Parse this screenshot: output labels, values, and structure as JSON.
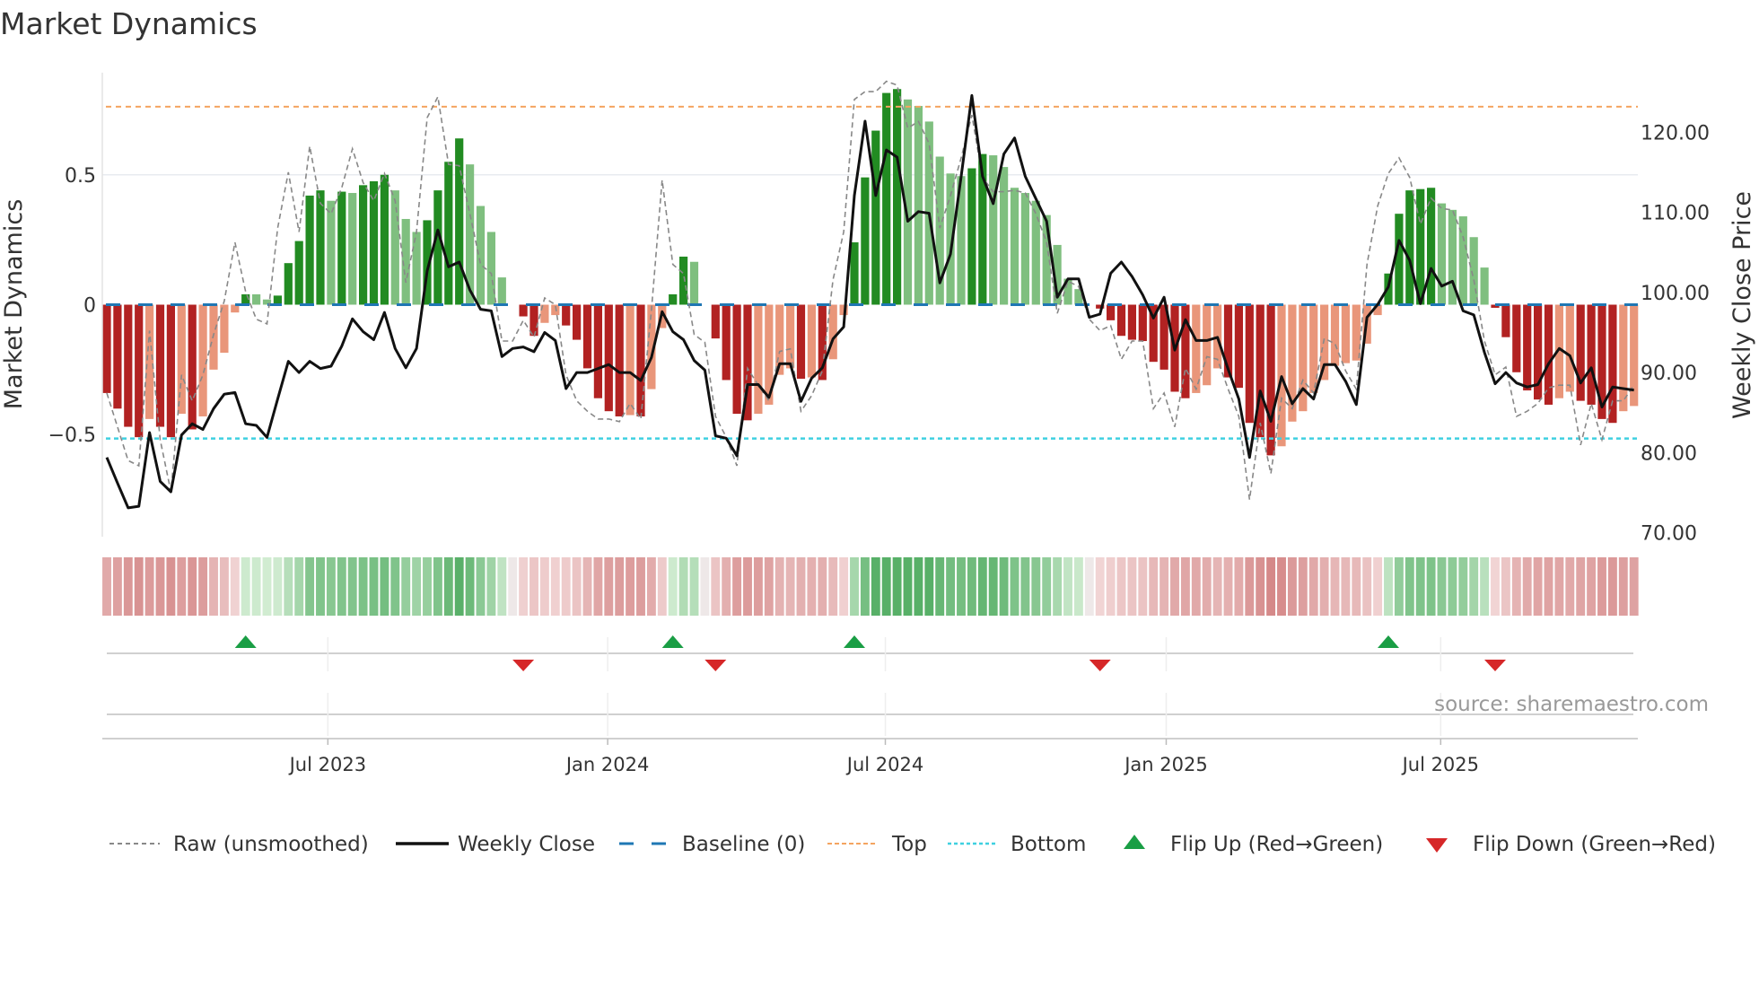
{
  "chart_data": {
    "type": "bar",
    "title": "Market Dynamics",
    "ylabel_left": "Market Dynamics",
    "ylabel_right": "Weekly Close Price",
    "ylim_left": [
      -0.893,
      0.893
    ],
    "ylim_right": [
      69.5,
      127.45
    ],
    "left_ticks": [
      {
        "v": 0.5,
        "label": "0.5"
      },
      {
        "v": 0,
        "label": "0"
      },
      {
        "v": -0.5,
        "label": "−0.5"
      }
    ],
    "right_ticks": [
      {
        "v": 120,
        "label": "120.00"
      },
      {
        "v": 110,
        "label": "110.00"
      },
      {
        "v": 100,
        "label": "100.00"
      },
      {
        "v": 90,
        "label": "90.00"
      },
      {
        "v": 80,
        "label": "80.00"
      },
      {
        "v": 70,
        "label": "70.00"
      }
    ],
    "x_unit": "week index",
    "x_ticks": [
      {
        "week": 20.7,
        "label": "Jul 2023"
      },
      {
        "week": 46.9,
        "label": "Jan 2024"
      },
      {
        "week": 72.9,
        "label": "Jul 2024"
      },
      {
        "week": 99.2,
        "label": "Jan 2025"
      },
      {
        "week": 124.9,
        "label": "Jul 2025"
      }
    ],
    "top_level": 0.762,
    "bottom_level": -0.515,
    "baseline": 0,
    "momentum": [
      -0.34,
      -0.4,
      -0.47,
      -0.51,
      -0.44,
      -0.47,
      -0.51,
      -0.42,
      -0.48,
      -0.43,
      -0.25,
      -0.185,
      -0.03,
      0.04,
      0.04,
      0.02,
      0.035,
      0.16,
      0.245,
      0.42,
      0.44,
      0.4,
      0.435,
      0.43,
      0.46,
      0.475,
      0.5,
      0.44,
      0.33,
      0.28,
      0.325,
      0.44,
      0.55,
      0.64,
      0.54,
      0.38,
      0.28,
      0.105,
      0,
      -0.045,
      -0.12,
      -0.07,
      -0.04,
      -0.08,
      -0.135,
      -0.245,
      -0.36,
      -0.41,
      -0.43,
      -0.425,
      -0.43,
      -0.325,
      -0.09,
      0.04,
      0.185,
      0.165,
      0,
      -0.13,
      -0.29,
      -0.42,
      -0.445,
      -0.42,
      -0.385,
      -0.27,
      -0.245,
      -0.285,
      -0.28,
      -0.29,
      -0.21,
      -0.04,
      0.24,
      0.49,
      0.67,
      0.815,
      0.83,
      0.79,
      0.765,
      0.705,
      0.57,
      0.505,
      0.495,
      0.525,
      0.58,
      0.575,
      0.53,
      0.45,
      0.43,
      0.4,
      0.345,
      0.23,
      0.1,
      0.06,
      0,
      -0.015,
      -0.06,
      -0.12,
      -0.135,
      -0.14,
      -0.22,
      -0.25,
      -0.335,
      -0.36,
      -0.34,
      -0.31,
      -0.245,
      -0.28,
      -0.32,
      -0.455,
      -0.51,
      -0.58,
      -0.545,
      -0.45,
      -0.41,
      -0.34,
      -0.29,
      -0.235,
      -0.225,
      -0.215,
      -0.15,
      -0.04,
      0.12,
      0.35,
      0.44,
      0.445,
      0.45,
      0.39,
      0.365,
      0.34,
      0.26,
      0.143,
      -0.012,
      -0.125,
      -0.26,
      -0.33,
      -0.365,
      -0.385,
      -0.36,
      -0.335,
      -0.37,
      -0.385,
      -0.44,
      -0.455,
      -0.41,
      -0.39
    ],
    "raw": [
      -0.34,
      -0.47,
      -0.6,
      -0.62,
      -0.1,
      -0.52,
      -0.72,
      -0.27,
      -0.37,
      -0.27,
      -0.115,
      0.014,
      0.24,
      0.05,
      -0.056,
      -0.074,
      0.295,
      0.51,
      0.28,
      0.61,
      0.39,
      0.35,
      0.45,
      0.6,
      0.47,
      0.4,
      0.505,
      0.4,
      0.085,
      0.28,
      0.72,
      0.8,
      0.54,
      0.535,
      0.35,
      0.155,
      0.12,
      -0.14,
      -0.14,
      -0.06,
      -0.125,
      0.026,
      0.0,
      -0.27,
      -0.37,
      -0.41,
      -0.44,
      -0.44,
      -0.45,
      -0.38,
      -0.44,
      -0.02,
      0.48,
      0.155,
      0.12,
      -0.115,
      -0.145,
      -0.43,
      -0.51,
      -0.62,
      -0.245,
      -0.31,
      -0.37,
      -0.18,
      -0.17,
      -0.41,
      -0.35,
      -0.255,
      0.096,
      0.28,
      0.79,
      0.82,
      0.82,
      0.86,
      0.845,
      0.68,
      0.705,
      0.62,
      0.295,
      0.42,
      0.565,
      0.73,
      0.49,
      0.435,
      0.435,
      0.44,
      0.43,
      0.35,
      0.24,
      -0.033,
      0.09,
      0.07,
      -0.056,
      -0.1,
      -0.08,
      -0.21,
      -0.14,
      -0.14,
      -0.4,
      -0.34,
      -0.47,
      -0.245,
      -0.325,
      -0.2,
      -0.21,
      -0.325,
      -0.43,
      -0.75,
      -0.455,
      -0.65,
      -0.36,
      -0.4,
      -0.29,
      -0.34,
      -0.13,
      -0.15,
      -0.255,
      -0.325,
      0.155,
      0.38,
      0.505,
      0.565,
      0.49,
      0.31,
      0.41,
      0.37,
      0.365,
      0.26,
      0.096,
      -0.14,
      -0.27,
      -0.24,
      -0.43,
      -0.41,
      -0.38,
      -0.32,
      -0.31,
      -0.31,
      -0.54,
      -0.38,
      -0.52,
      -0.37,
      -0.37,
      -0.31
    ],
    "weekly_close": [
      79.4,
      76.2,
      73.1,
      73.3,
      82.5,
      76.4,
      75.1,
      82.2,
      83.6,
      82.9,
      85.5,
      87.3,
      87.5,
      83.6,
      83.4,
      81.9,
      86.7,
      91.4,
      90.0,
      91.4,
      90.5,
      90.8,
      93.3,
      96.7,
      95.1,
      94.1,
      97.5,
      93.0,
      90.6,
      93.0,
      102.7,
      107.8,
      103.2,
      103.8,
      100.3,
      97.9,
      97.7,
      92.0,
      93.0,
      93.2,
      92.6,
      95.0,
      94.0,
      88.0,
      90.0,
      90.0,
      90.5,
      91.0,
      90.0,
      90.0,
      89.0,
      91.9,
      97.6,
      95.1,
      94.1,
      91.5,
      90.3,
      82.1,
      81.8,
      79.6,
      88.5,
      88.5,
      86.9,
      91.1,
      91.1,
      86.4,
      89.3,
      90.6,
      94.2,
      95.7,
      112.1,
      121.4,
      112.1,
      117.8,
      116.9,
      108.9,
      110.1,
      109.9,
      101.2,
      104.8,
      114.5,
      124.6,
      114.5,
      111.1,
      117.3,
      119.3,
      114.5,
      111.7,
      108.9,
      99.4,
      101.7,
      101.7,
      96.9,
      97.3,
      102.4,
      103.8,
      102.0,
      99.7,
      96.8,
      99.4,
      92.8,
      96.6,
      94.0,
      94.0,
      94.4,
      90.4,
      86.7,
      79.4,
      87.7,
      83.9,
      89.5,
      86.1,
      88.0,
      86.7,
      91.0,
      91.0,
      88.9,
      86.0,
      96.9,
      98.5,
      100.7,
      106.5,
      104.0,
      98.6,
      103.0,
      100.8,
      101.4,
      97.7,
      97.2,
      92.5,
      88.6,
      90.0,
      88.7,
      88.2,
      88.5,
      91.1,
      93.0,
      92.1,
      88.7,
      90.6,
      85.7,
      88.2,
      88.0,
      87.8
    ],
    "flip_up_weeks": [
      13,
      53,
      70,
      120
    ],
    "flip_down_weeks": [
      39,
      57,
      93,
      130
    ],
    "legend": {
      "placement": "bottom",
      "raw": "Raw (unsmoothed)",
      "close": "Weekly Close",
      "baseline": "Baseline (0)",
      "top": "Top",
      "bottom": "Bottom",
      "flip_up": "Flip Up (Red→Green)",
      "flip_down": "Flip Down (Green→Red)"
    },
    "source": "source: sharemaestro.com",
    "colors": {
      "pos_strong": "#228b22",
      "pos_weak": "#7fbf7f",
      "neg_strong": "#b22222",
      "neg_weak": "#e9967a",
      "close": "#111111",
      "raw": "#888888",
      "baseline": "#1f77b4",
      "top": "#f4a460",
      "bottom": "#3fd0e0",
      "flip_up": "#1a9e45",
      "flip_down": "#d62728"
    }
  }
}
